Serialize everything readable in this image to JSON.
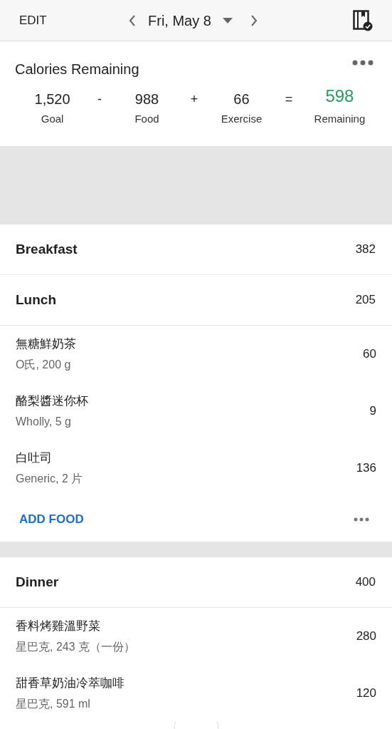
{
  "header": {
    "edit": "EDIT",
    "date": "Fri, May 8"
  },
  "summary": {
    "title": "Calories Remaining",
    "terms": [
      {
        "value": "1,520",
        "label": "Goal",
        "op": "-"
      },
      {
        "value": "988",
        "label": "Food",
        "op": "+"
      },
      {
        "value": "66",
        "label": "Exercise",
        "op": "="
      },
      {
        "value": "598",
        "label": "Remaining",
        "kind": "result"
      }
    ]
  },
  "meals": [
    {
      "name": "Breakfast",
      "calories": "382"
    },
    {
      "name": "Lunch",
      "calories": "205",
      "items": [
        {
          "name": "無糖鮮奶茶",
          "detail": "O氏, 200 g",
          "calories": "60"
        },
        {
          "name": "酪梨醬迷你杯",
          "detail": "Wholly, 5 g",
          "calories": "9"
        },
        {
          "name": "白吐司",
          "detail": "Generic, 2 片",
          "calories": "136"
        }
      ],
      "add_label": "ADD FOOD"
    },
    {
      "name": "Dinner",
      "calories": "400",
      "items": [
        {
          "name": "香料烤雞溫野菜",
          "detail": "星巴克, 243 克（一份）",
          "calories": "280"
        },
        {
          "name": "甜香草奶油冷萃咖啡",
          "detail": "星巴克, 591 ml",
          "calories": "120"
        }
      ]
    }
  ]
}
